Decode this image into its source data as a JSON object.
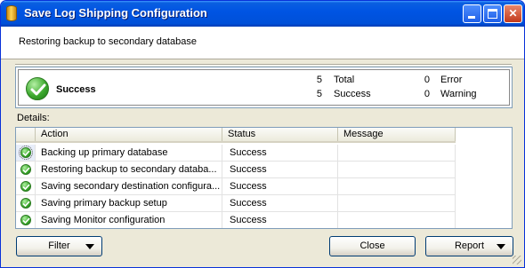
{
  "window": {
    "title": "Save Log Shipping Configuration",
    "icon": "database-cylinder-icon",
    "controls": {
      "minimize": "minimize-icon",
      "maximize": "maximize-icon",
      "close": "✕"
    }
  },
  "header": {
    "text": "Restoring backup to secondary database"
  },
  "summary": {
    "status": "Success",
    "status_icon": "success-check-icon",
    "total_count": "5",
    "total_label": "Total",
    "success_count": "5",
    "success_label": "Success",
    "error_count": "0",
    "error_label": "Error",
    "warning_count": "0",
    "warning_label": "Warning"
  },
  "details": {
    "label": "Details:",
    "columns": [
      "Action",
      "Status",
      "Message"
    ],
    "rows": [
      {
        "action": "Backing up primary database",
        "status": "Success",
        "message": ""
      },
      {
        "action": "Restoring backup to secondary databa...",
        "status": "Success",
        "message": ""
      },
      {
        "action": "Saving secondary destination configura...",
        "status": "Success",
        "message": ""
      },
      {
        "action": "Saving primary backup setup",
        "status": "Success",
        "message": ""
      },
      {
        "action": "Saving Monitor configuration",
        "status": "Success",
        "message": ""
      }
    ]
  },
  "buttons": {
    "filter": "Filter",
    "close": "Close",
    "report": "Report"
  },
  "colors": {
    "titlebar": "#0054e3",
    "dialog": "#ece9d8",
    "success": "#3ca92e"
  }
}
